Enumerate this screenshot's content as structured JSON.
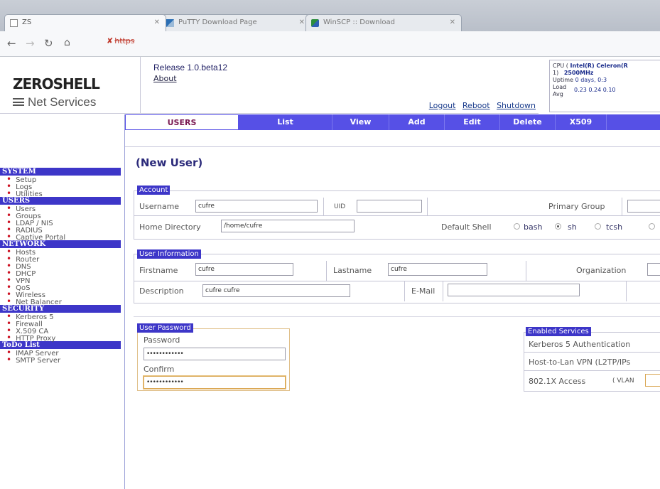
{
  "browser": {
    "tabs": [
      {
        "label": "ZS"
      },
      {
        "label": "PuTTY Download Page"
      },
      {
        "label": "WinSCP :: Download"
      }
    ],
    "url_scheme": "https"
  },
  "header": {
    "logo_title": "ZEROSHELL",
    "logo_subtitle": "Net Services",
    "release": "Release 1.0.beta12",
    "about": "About",
    "links": {
      "logout": "Logout",
      "reboot": "Reboot",
      "shutdown": "Shutdown"
    },
    "sysinfo": {
      "cpu_label": "CPU (",
      "cpu_value": "Intel(R) Celeron(R",
      "cpu_count": "1)",
      "cpu_mhz": "2500MHz",
      "uptime_label": "Uptime",
      "uptime_value": "0 days, 0:3",
      "load_label": "Load",
      "load_avg_label": "Avg",
      "load_value": "0.23 0.24 0.10"
    }
  },
  "menu": {
    "items": [
      "USERS",
      "List",
      "View",
      "Add",
      "Edit",
      "Delete",
      "X509"
    ]
  },
  "sidebar": {
    "sections": [
      {
        "title": "SYSTEM",
        "items": [
          "Setup",
          "Logs",
          "Utilities"
        ]
      },
      {
        "title": "USERS",
        "items": [
          "Users",
          "Groups",
          "LDAP / NIS",
          "RADIUS",
          "Captive Portal"
        ]
      },
      {
        "title": "NETWORK",
        "items": [
          "Hosts",
          "Router",
          "DNS",
          "DHCP",
          "VPN",
          "QoS",
          "Wireless",
          "Net Balancer"
        ]
      },
      {
        "title": "SECURITY",
        "items": [
          "Kerberos 5",
          "Firewall",
          "X.509 CA",
          "HTTP Proxy"
        ]
      },
      {
        "title": "ToDo List",
        "items": [
          "IMAP Server",
          "SMTP Server"
        ]
      }
    ]
  },
  "page_title": "(New User)",
  "account": {
    "title": "Account",
    "username_label": "Username",
    "username_value": "cufre",
    "uid_label": "UID",
    "uid_value": "",
    "primary_group_label": "Primary Group",
    "home_label": "Home Directory",
    "home_value": "/home/cufre",
    "shell_label": "Default Shell",
    "shells": [
      {
        "label": "bash",
        "selected": false
      },
      {
        "label": "sh",
        "selected": true
      },
      {
        "label": "tcsh",
        "selected": false
      }
    ]
  },
  "user_info": {
    "title": "User Information",
    "firstname_label": "Firstname",
    "firstname_value": "cufre",
    "lastname_label": "Lastname",
    "lastname_value": "cufre",
    "organization_label": "Organization",
    "description_label": "Description",
    "description_value": "cufre cufre",
    "email_label": "E-Mail",
    "email_value": ""
  },
  "password": {
    "title": "User Password",
    "password_label": "Password",
    "password_value": "••••••••••••",
    "confirm_label": "Confirm",
    "confirm_value": "••••••••••••"
  },
  "services": {
    "title": "Enabled Services",
    "items": [
      "Kerberos 5 Authentication",
      "Host-to-Lan VPN (L2TP/IPs",
      "802.1X Access"
    ],
    "vlan_label": "( VLAN"
  },
  "colors": {
    "menu_bg": "#5650e6",
    "section_bg": "#3d36c8",
    "bullet": "#cc1122",
    "title": "#2b2a7a"
  }
}
